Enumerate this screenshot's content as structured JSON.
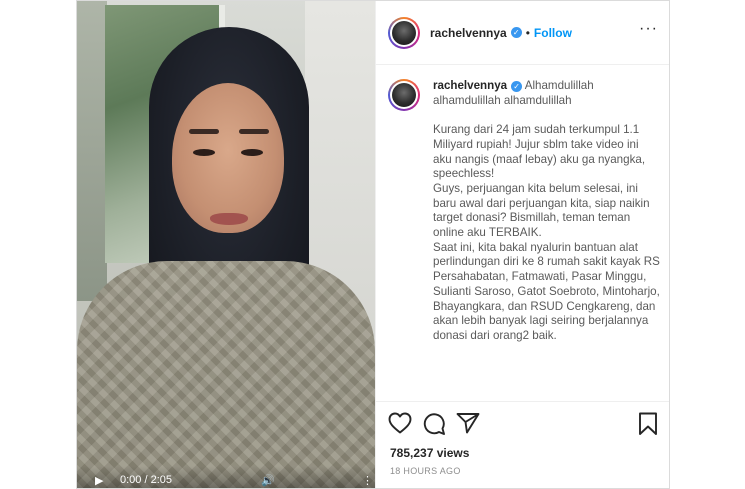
{
  "video": {
    "time_display": "0:00 / 2:05",
    "play_label": "▶",
    "volume_label": "🔊",
    "more_label": "⋮"
  },
  "header": {
    "username": "rachelvennya",
    "verified_label": "✓",
    "separator": "•",
    "follow_label": "Follow",
    "menu_label": "···"
  },
  "caption": {
    "username": "rachelvennya",
    "text": "Alhamdulillah alhamdulillah alhamdulillah\n\nKurang dari 24 jam sudah terkumpul 1.1 Miliyard rupiah! Jujur sblm take video ini aku nangis (maaf lebay) aku ga nyangka, speechless!\nGuys, perjuangan kita belum selesai, ini baru awal dari perjuangan kita, siap naikin target donasi? Bismillah, teman teman online aku TERBAIK.\nSaat ini, kita bakal nyalurin bantuan alat perlindungan diri ke 8 rumah sakit kayak RS Persahabatan, Fatmawati, Pasar Minggu, Sulianti Saroso, Gatot Soebroto, Mintoharjo, Bhayangkara, dan RSUD Cengkareng, dan akan lebih banyak lagi seiring berjalannya donasi dari orang2 baik."
  },
  "actions": {
    "views": "785,237 views",
    "time_ago": "18 HOURS AGO",
    "icons": [
      "heart-icon",
      "comment-icon",
      "share-icon",
      "bookmark-icon"
    ]
  },
  "colors": {
    "accent": "#0095f6",
    "verified": "#3897f0",
    "text": "#262626",
    "muted": "#8e8e8e"
  }
}
